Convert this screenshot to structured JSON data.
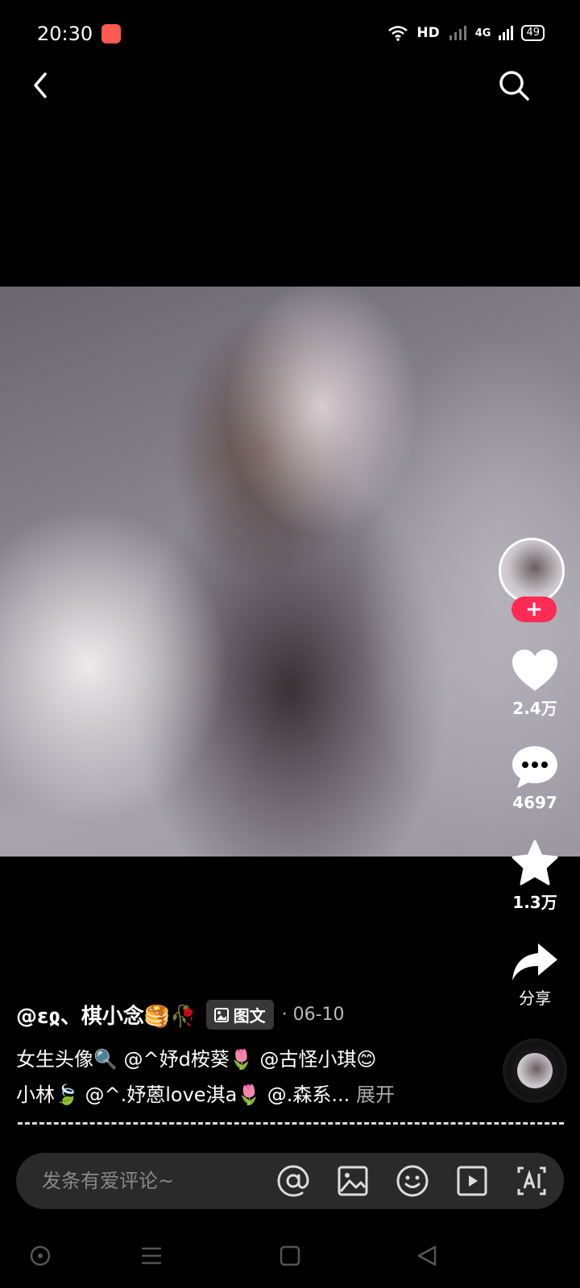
{
  "status_bar": {
    "time": "20:30",
    "network": "HD",
    "signal_label": "4G",
    "battery": "49"
  },
  "header": {
    "back_icon": "chevron-left-icon",
    "search_icon": "search-icon"
  },
  "post": {
    "author": "@ɛჲ、棋小念🥞🥀",
    "tag": "图文",
    "date": "· 06-10",
    "caption_line1": "女生头像🔍 @^妤d桉葵🌷 @古怪小琪😊",
    "caption_line2": "小林🍃 @^.妤蒽love淇a🌷 @.森系...",
    "expand": "展开"
  },
  "actions": {
    "follow_label": "+",
    "like_count": "2.4万",
    "comment_count": "4697",
    "favorite_count": "1.3万",
    "share_label": "分享"
  },
  "comment_bar": {
    "placeholder": "发条有爱评论~",
    "icons": [
      "at-icon",
      "image-icon",
      "emoji-icon",
      "video-icon",
      "ai-icon"
    ]
  },
  "colors": {
    "accent": "#fe2c55",
    "background": "#000000",
    "input_bg": "#2a2a2a"
  }
}
